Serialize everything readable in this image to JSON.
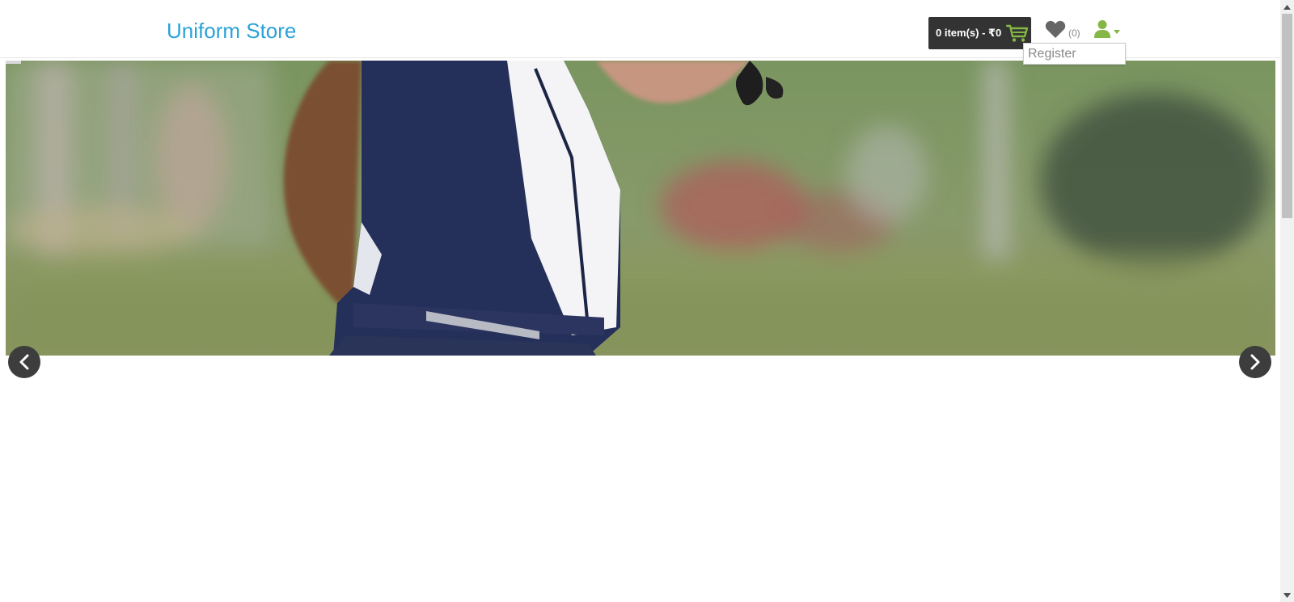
{
  "header": {
    "logo_text": "Uniform Store",
    "cart_label": "0 item(s) - ₹0",
    "wishlist_count": "(0)"
  },
  "account_menu": {
    "items": [
      {
        "label": "Register"
      }
    ]
  },
  "icons": {
    "cart": "shopping-cart-icon",
    "wishlist": "heart-icon",
    "account": "user-icon",
    "caret": "caret-down-icon",
    "prev": "chevron-left-icon",
    "next": "chevron-right-icon"
  },
  "colors": {
    "brand": "#2aa2d6",
    "cart_background": "#333333",
    "accent_green": "#84b744",
    "icon_gray": "#666666"
  }
}
